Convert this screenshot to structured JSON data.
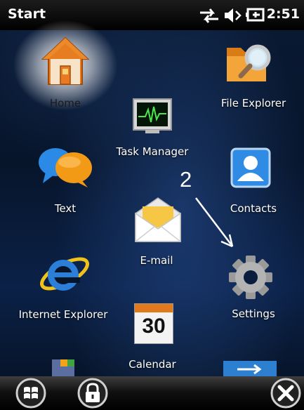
{
  "status_bar": {
    "title": "Start",
    "time": "2:51",
    "icons": [
      "data-sync-icon",
      "volume-icon",
      "battery-charging-icon"
    ]
  },
  "tiles": [
    {
      "id": "home",
      "label": "Home",
      "icon": "house-icon"
    },
    {
      "id": "file-explorer",
      "label": "File Explorer",
      "icon": "folder-magnifier-icon"
    },
    {
      "id": "task-manager",
      "label": "Task Manager",
      "icon": "heartbeat-monitor-icon"
    },
    {
      "id": "text",
      "label": "Text",
      "icon": "speech-bubbles-icon"
    },
    {
      "id": "contacts",
      "label": "Contacts",
      "icon": "contact-card-icon"
    },
    {
      "id": "email",
      "label": "E-mail",
      "icon": "envelope-icon"
    },
    {
      "id": "internet-explorer",
      "label": "Internet Explorer",
      "icon": "ie-logo-icon"
    },
    {
      "id": "settings",
      "label": "Settings",
      "icon": "gear-icon"
    },
    {
      "id": "calendar",
      "label": "Calendar",
      "icon": "calendar-icon",
      "day": "30"
    }
  ],
  "annotation": {
    "number": "2"
  },
  "bottom_bar": {
    "buttons": [
      "windows-start-icon",
      "lock-icon",
      "close-icon"
    ]
  }
}
